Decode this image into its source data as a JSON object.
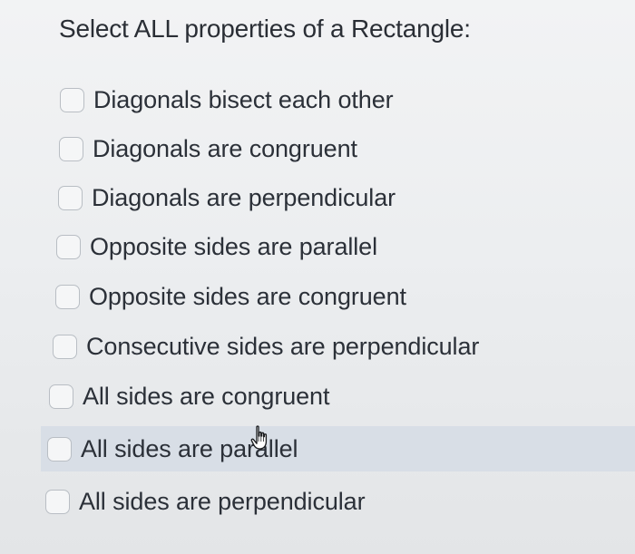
{
  "question": {
    "text": "Select ALL properties of a Rectangle:"
  },
  "options": [
    {
      "label": "Diagonals bisect each other",
      "checked": false
    },
    {
      "label": "Diagonals are congruent",
      "checked": false
    },
    {
      "label": "Diagonals are perpendicular",
      "checked": false
    },
    {
      "label": "Opposite sides are parallel",
      "checked": false
    },
    {
      "label": "Opposite sides are congruent",
      "checked": false
    },
    {
      "label": "Consecutive sides are perpendicular",
      "checked": false
    },
    {
      "label": "All sides are congruent",
      "checked": false
    },
    {
      "label": "All sides are parallel",
      "checked": false,
      "hovered": true
    },
    {
      "label": "All sides are perpendicular",
      "checked": false
    }
  ],
  "colors": {
    "background": "#eceef0",
    "hover_highlight": "#d8dee6",
    "checkbox_border": "#b9bec4",
    "text": "#2b3038"
  },
  "cursor": {
    "icon": "hand-pointer-icon"
  }
}
